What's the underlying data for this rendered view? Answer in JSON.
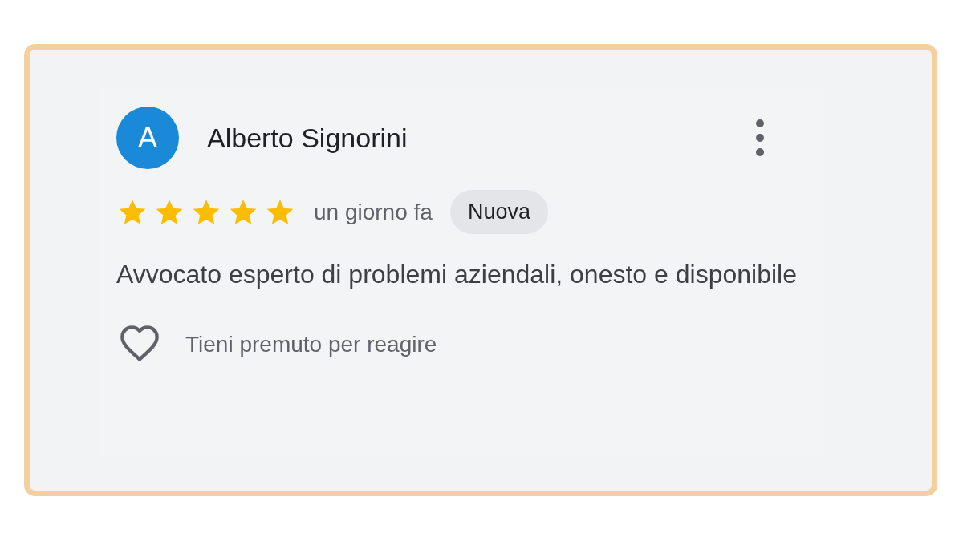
{
  "review": {
    "avatar_letter": "A",
    "author": "Alberto Signorini",
    "stars": 5,
    "time": "un giorno fa",
    "badge": "Nuova",
    "text": "Avvocato esperto di problemi aziendali, onesto e disponibile",
    "reaction_hint": "Tieni premuto per reagire"
  }
}
